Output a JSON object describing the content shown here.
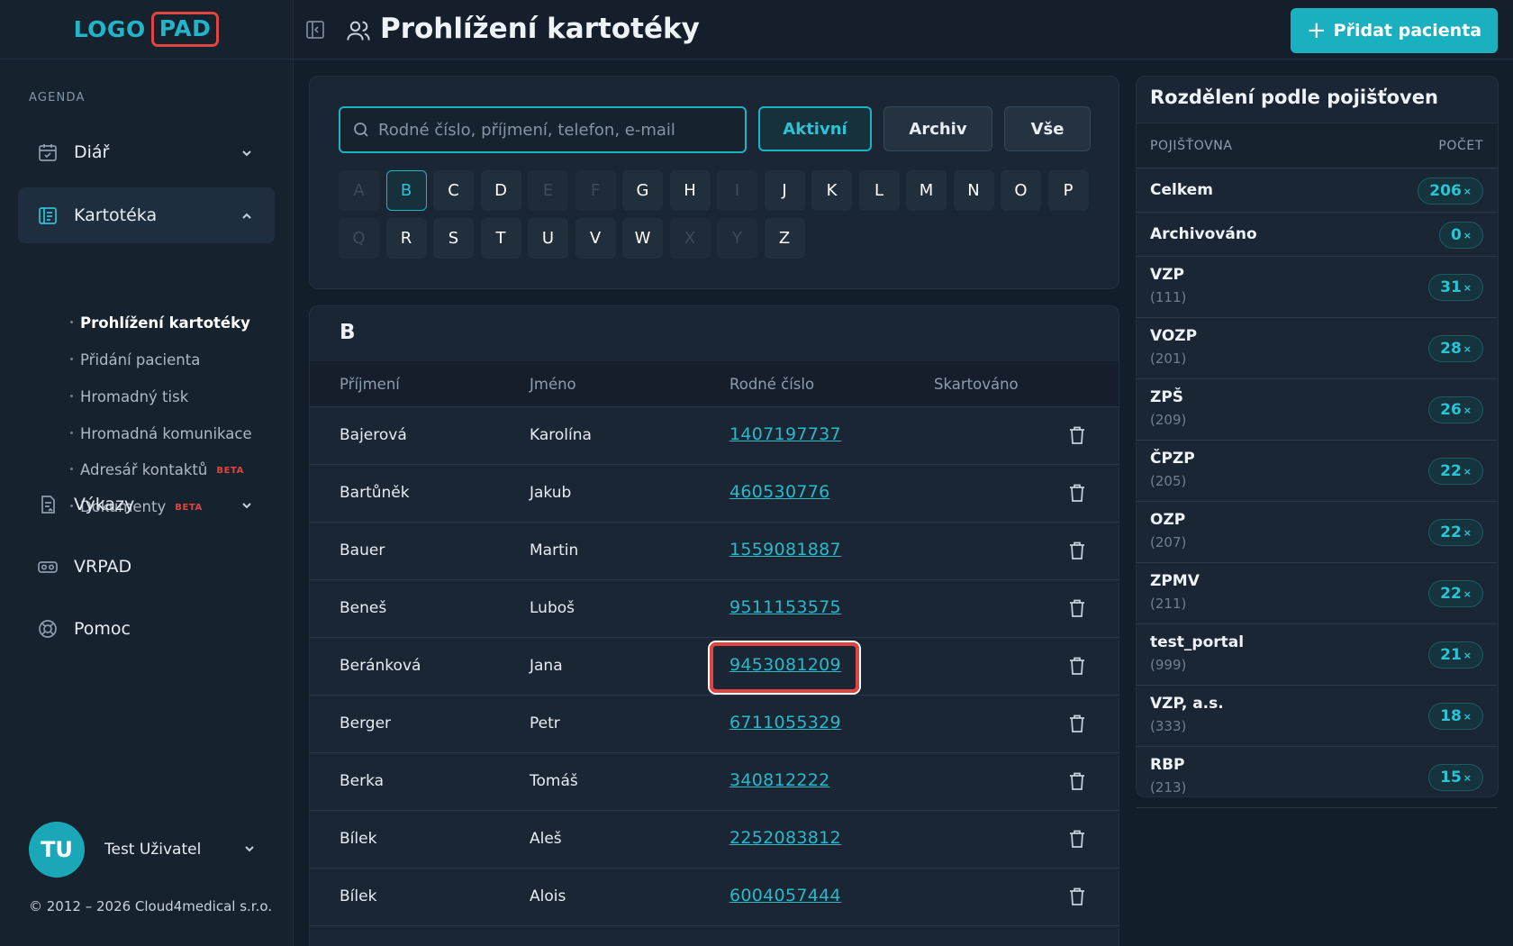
{
  "logo": {
    "left": "LOGO",
    "right": "PAD"
  },
  "sidebar": {
    "section_label": "AGENDA",
    "items": [
      {
        "label": "Diář",
        "icon": "calendar-icon"
      },
      {
        "label": "Kartotéka",
        "icon": "file-index-icon"
      },
      {
        "label": "Výkazy",
        "icon": "report-icon"
      },
      {
        "label": "VRPAD",
        "icon": "vr-headset-icon"
      },
      {
        "label": "Pomoc",
        "icon": "lifebuoy-icon"
      }
    ],
    "subitems": [
      {
        "label": "Prohlížení kartotéky",
        "beta": ""
      },
      {
        "label": "Přidání pacienta",
        "beta": ""
      },
      {
        "label": "Hromadný tisk",
        "beta": ""
      },
      {
        "label": "Hromadná komunikace",
        "beta": ""
      },
      {
        "label": "Adresář kontaktů",
        "beta": "BETA"
      },
      {
        "label": "Dokumenty",
        "beta": "BETA"
      }
    ],
    "user": {
      "initials": "TU",
      "name": "Test Uživatel"
    },
    "copyright": "© 2012 – 2026 Cloud4medical s.r.o."
  },
  "header": {
    "title": "Prohlížení kartotéky",
    "add_button": "Přidat pacienta"
  },
  "filter": {
    "search_placeholder": "Rodné číslo, příjmení, telefon, e-mail",
    "buttons": [
      "Aktivní",
      "Archiv",
      "Vše"
    ],
    "selected_letter": "B",
    "letters": [
      {
        "l": "A",
        "enabled": false
      },
      {
        "l": "B",
        "enabled": true
      },
      {
        "l": "C",
        "enabled": true
      },
      {
        "l": "D",
        "enabled": true
      },
      {
        "l": "E",
        "enabled": false
      },
      {
        "l": "F",
        "enabled": false
      },
      {
        "l": "G",
        "enabled": true
      },
      {
        "l": "H",
        "enabled": true
      },
      {
        "l": "I",
        "enabled": false
      },
      {
        "l": "J",
        "enabled": true
      },
      {
        "l": "K",
        "enabled": true
      },
      {
        "l": "L",
        "enabled": true
      },
      {
        "l": "M",
        "enabled": true
      },
      {
        "l": "N",
        "enabled": true
      },
      {
        "l": "O",
        "enabled": true
      },
      {
        "l": "P",
        "enabled": true
      },
      {
        "l": "Q",
        "enabled": false
      },
      {
        "l": "R",
        "enabled": true
      },
      {
        "l": "S",
        "enabled": true
      },
      {
        "l": "T",
        "enabled": true
      },
      {
        "l": "U",
        "enabled": true
      },
      {
        "l": "V",
        "enabled": true
      },
      {
        "l": "W",
        "enabled": true
      },
      {
        "l": "X",
        "enabled": false
      },
      {
        "l": "Y",
        "enabled": false
      },
      {
        "l": "Z",
        "enabled": true
      }
    ]
  },
  "table": {
    "group_letter": "B",
    "columns": [
      "Příjmení",
      "Jméno",
      "Rodné číslo",
      "Skartováno"
    ],
    "rows": [
      {
        "surname": "Bajerová",
        "name": "Karolína",
        "rc": "1407197737"
      },
      {
        "surname": "Bartůněk",
        "name": "Jakub",
        "rc": "460530776"
      },
      {
        "surname": "Bauer",
        "name": "Martin",
        "rc": "1559081887"
      },
      {
        "surname": "Beneš",
        "name": "Luboš",
        "rc": "9511153575"
      },
      {
        "surname": "Beránková",
        "name": "Jana",
        "rc": "9453081209",
        "highlighted": true
      },
      {
        "surname": "Berger",
        "name": "Petr",
        "rc": "6711055329"
      },
      {
        "surname": "Berka",
        "name": "Tomáš",
        "rc": "340812222"
      },
      {
        "surname": "Bílek",
        "name": "Aleš",
        "rc": "2252083812"
      },
      {
        "surname": "Bílek",
        "name": "Alois",
        "rc": "6004057444"
      }
    ]
  },
  "insurance": {
    "title": "Rozdělení podle pojišťoven",
    "col_name": "POJIŠŤOVNA",
    "col_count": "POČET",
    "rows": [
      {
        "name": "Celkem",
        "code": "",
        "count": "206"
      },
      {
        "name": "Archivováno",
        "code": "",
        "count": "0"
      },
      {
        "name": "VZP",
        "code": "(111)",
        "count": "31"
      },
      {
        "name": "VOZP",
        "code": "(201)",
        "count": "28"
      },
      {
        "name": "ZPŠ",
        "code": "(209)",
        "count": "26"
      },
      {
        "name": "ČPZP",
        "code": "(205)",
        "count": "22"
      },
      {
        "name": "OZP",
        "code": "(207)",
        "count": "22"
      },
      {
        "name": "ZPMV",
        "code": "(211)",
        "count": "22"
      },
      {
        "name": "test_portal",
        "code": "(999)",
        "count": "21"
      },
      {
        "name": "VZP, a.s.",
        "code": "(333)",
        "count": "18"
      },
      {
        "name": "RBP",
        "code": "(213)",
        "count": "15"
      }
    ],
    "count_suffix": "×"
  },
  "colors": {
    "accent": "#1ab0c0",
    "highlight": "#e0453f",
    "beta": "#e0453f"
  }
}
